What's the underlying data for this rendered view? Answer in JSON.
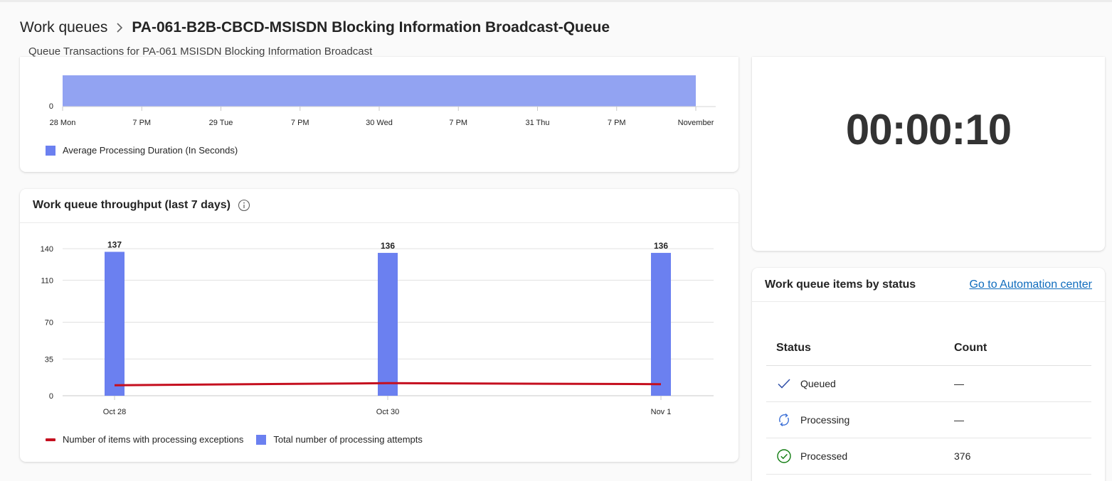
{
  "breadcrumb": {
    "parent": "Work queues",
    "current": "PA-061-B2B-CBCD-MSISDN Blocking Information Broadcast-Queue"
  },
  "subtitle": "Queue Transactions for PA-061 MSISDN Blocking Information Broadcast",
  "duration_card": {
    "legend": "Average Processing Duration (In Seconds)"
  },
  "throughput_card": {
    "title": "Work queue throughput (last 7 days)",
    "legend_exceptions": "Number of items with processing exceptions",
    "legend_attempts": "Total number of processing attempts"
  },
  "timer_card": {
    "value": "00:00:10"
  },
  "status_card": {
    "title": "Work queue items by status",
    "link": "Go to Automation center",
    "col_status": "Status",
    "col_count": "Count",
    "rows": [
      {
        "status": "Queued",
        "count": "—",
        "icon": "checkmark-icon"
      },
      {
        "status": "Processing",
        "count": "—",
        "icon": "refresh-icon"
      },
      {
        "status": "Processed",
        "count": "376",
        "icon": "check-circle-icon"
      }
    ]
  },
  "colors": {
    "bar_blue": "#6b80f0",
    "area_blue": "#92a3f2",
    "exceptions_red": "#c50f1f",
    "link_blue": "#0f6cbd"
  },
  "chart_data": [
    {
      "type": "area",
      "series": [
        {
          "name": "Average Processing Duration (In Seconds)"
        }
      ],
      "y_visible_ticks": [
        0
      ],
      "x_tick_labels": [
        "28 Mon",
        "7 PM",
        "29 Tue",
        "7 PM",
        "30 Wed",
        "7 PM",
        "31 Thu",
        "7 PM",
        "November"
      ],
      "legend": "bottom-left"
    },
    {
      "type": "bar",
      "title": "Work queue throughput (last 7 days)",
      "categories": [
        "Oct 28",
        "Oct 30",
        "Nov 1"
      ],
      "ylim": [
        0,
        140
      ],
      "yticks": [
        0,
        35,
        70,
        110,
        140
      ],
      "series": [
        {
          "name": "Total number of processing attempts",
          "type": "bar",
          "values": [
            137,
            136,
            136
          ],
          "labels": [
            "137",
            "136",
            "136"
          ]
        },
        {
          "name": "Number of items with processing exceptions",
          "type": "line",
          "values": [
            10,
            12,
            11
          ]
        }
      ],
      "grid": true,
      "legend": "bottom-left"
    }
  ]
}
